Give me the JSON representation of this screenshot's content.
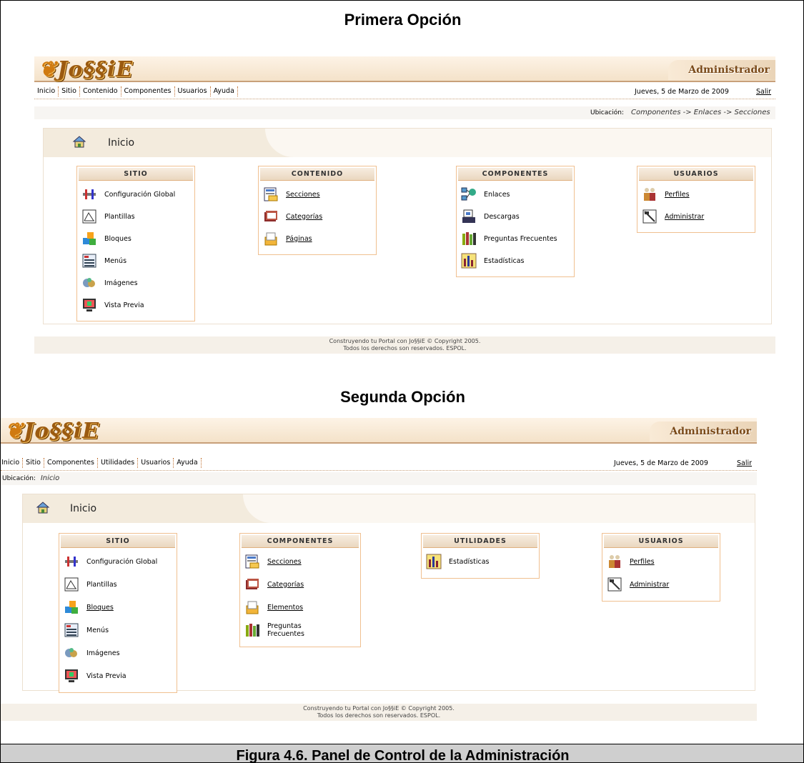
{
  "figure": {
    "title1": "Primera Opción",
    "title2": "Segunda Opción",
    "caption": "Figura 4.6. Panel de Control de la Administración"
  },
  "colors": {
    "banner": "#f4e2c9",
    "border": "#c8a07a",
    "box_border": "#f0c090",
    "caption_bg": "#cfcfcf"
  },
  "app": {
    "logo": "Jo§§iE",
    "admin_label": "Administrador",
    "date": "Jueves, 5 de Marzo de 2009",
    "logout": "Salir",
    "location_label": "Ubicación:",
    "copyright_line1": "Construyendo tu Portal con Jo§§iE © Copyright 2005.",
    "copyright_line2": "Todos los derechos son reservados. ESPOL.",
    "home_title": "Inicio"
  },
  "option1": {
    "menu": [
      "Inicio",
      "Sitio",
      "Contenido",
      "Componentes",
      "Usuarios",
      "Ayuda"
    ],
    "location": "Componentes -> Enlaces -> Secciones",
    "boxes": [
      {
        "title": "SITIO",
        "items": [
          {
            "label": "Configuración Global",
            "icon": "tools-icon",
            "link": false
          },
          {
            "label": "Plantillas",
            "icon": "template-icon",
            "link": false
          },
          {
            "label": "Bloques",
            "icon": "blocks-icon",
            "link": false
          },
          {
            "label": "Menús",
            "icon": "menu-icon",
            "link": false
          },
          {
            "label": "Imágenes",
            "icon": "images-icon",
            "link": false
          },
          {
            "label": "Vista Previa",
            "icon": "preview-icon",
            "link": false
          }
        ]
      },
      {
        "title": "CONTENIDO",
        "items": [
          {
            "label": "Secciones",
            "icon": "sections-icon",
            "link": true
          },
          {
            "label": "Categorías",
            "icon": "categories-icon",
            "link": true
          },
          {
            "label": "Páginas",
            "icon": "pages-icon",
            "link": true
          }
        ]
      },
      {
        "title": "COMPONENTES",
        "items": [
          {
            "label": "Enlaces",
            "icon": "links-icon",
            "link": false
          },
          {
            "label": "Descargas",
            "icon": "downloads-icon",
            "link": false
          },
          {
            "label": "Preguntas Frecuentes",
            "icon": "faq-icon",
            "link": false
          },
          {
            "label": "Estadísticas",
            "icon": "stats-icon",
            "link": false
          }
        ]
      },
      {
        "title": "USUARIOS",
        "items": [
          {
            "label": "Perfiles",
            "icon": "profiles-icon",
            "link": true
          },
          {
            "label": "Administrar",
            "icon": "admin-icon",
            "link": true
          }
        ]
      }
    ]
  },
  "option2": {
    "menu": [
      "Inicio",
      "Sitio",
      "Componentes",
      "Utilidades",
      "Usuarios",
      "Ayuda"
    ],
    "location": "Inicio",
    "boxes": [
      {
        "title": "SITIO",
        "items": [
          {
            "label": "Configuración Global",
            "icon": "tools-icon",
            "link": false
          },
          {
            "label": "Plantillas",
            "icon": "template-icon",
            "link": false
          },
          {
            "label": "Bloques",
            "icon": "blocks-icon",
            "link": true
          },
          {
            "label": "Menús",
            "icon": "menu-icon",
            "link": false
          },
          {
            "label": "Imágenes",
            "icon": "images-icon",
            "link": false
          },
          {
            "label": "Vista Previa",
            "icon": "preview-icon",
            "link": false
          }
        ]
      },
      {
        "title": "COMPONENTES",
        "items": [
          {
            "label": "Secciones",
            "icon": "sections-icon",
            "link": true
          },
          {
            "label": "Categorías",
            "icon": "categories-icon",
            "link": true
          },
          {
            "label": "Elementos",
            "icon": "pages-icon",
            "link": true
          },
          {
            "label": "Preguntas Frecuentes",
            "icon": "faq-icon",
            "link": false
          }
        ]
      },
      {
        "title": "UTILIDADES",
        "items": [
          {
            "label": "Estadísticas",
            "icon": "stats-icon",
            "link": false
          }
        ]
      },
      {
        "title": "USUARIOS",
        "items": [
          {
            "label": "Perfiles",
            "icon": "profiles-icon",
            "link": true
          },
          {
            "label": "Administrar",
            "icon": "admin-icon",
            "link": true
          }
        ]
      }
    ]
  }
}
